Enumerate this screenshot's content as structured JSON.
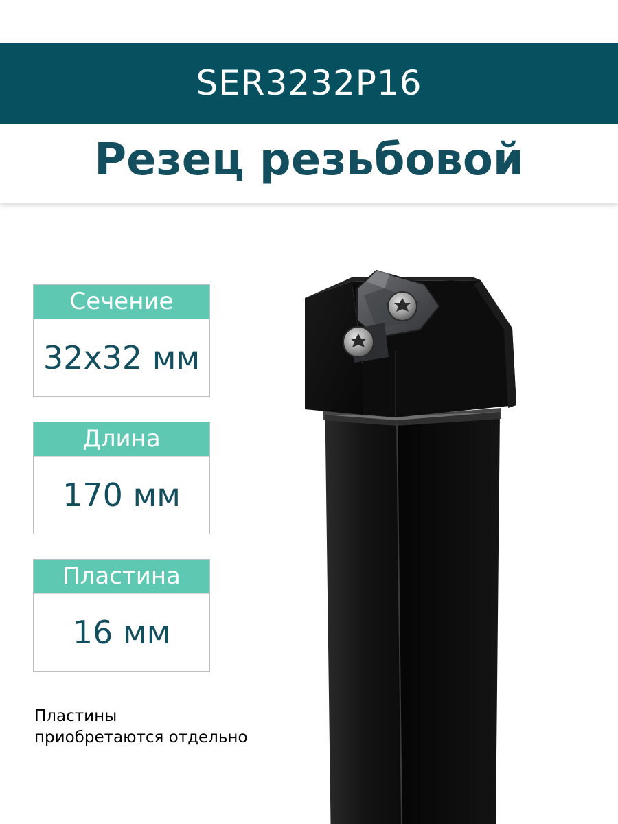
{
  "header": {
    "model_code": "SER3232P16",
    "title": "Резец резьбовой"
  },
  "specs": [
    {
      "label": "Сечение",
      "value": "32x32 мм"
    },
    {
      "label": "Длина",
      "value": "170 мм"
    },
    {
      "label": "Пластина",
      "value": "16 мм"
    }
  ],
  "note": {
    "line1": "Пластины",
    "line2": "приобретаются отдельно"
  },
  "colors": {
    "header_bar": "#07505f",
    "title_text": "#124e5e",
    "spec_label_bg": "#5ec8b2",
    "tool_body": "#0b0b0b"
  }
}
